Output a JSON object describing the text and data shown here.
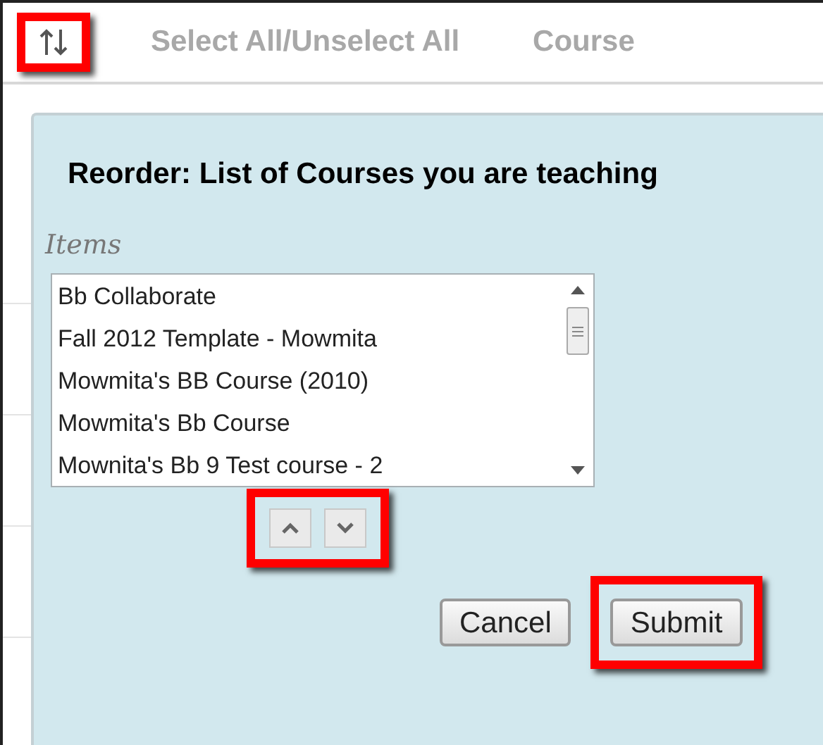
{
  "toolbar": {
    "reorder_button": {
      "highlighted": true
    },
    "links": [
      "Select All/Unselect All",
      "Course"
    ]
  },
  "dialog": {
    "title": "Reorder: List of Courses you are teaching",
    "list_label": "Items",
    "items": [
      "Bb Collaborate",
      "Fall 2012 Template - Mowmita",
      "Mowmita's BB Course (2010)",
      "Mowmita's Bb Course",
      "Mownita's Bb 9 Test course - 2"
    ],
    "move_buttons": {
      "highlighted": true
    },
    "buttons": [
      {
        "label": "Cancel",
        "highlighted": false
      },
      {
        "label": "Submit",
        "highlighted": true
      }
    ]
  }
}
